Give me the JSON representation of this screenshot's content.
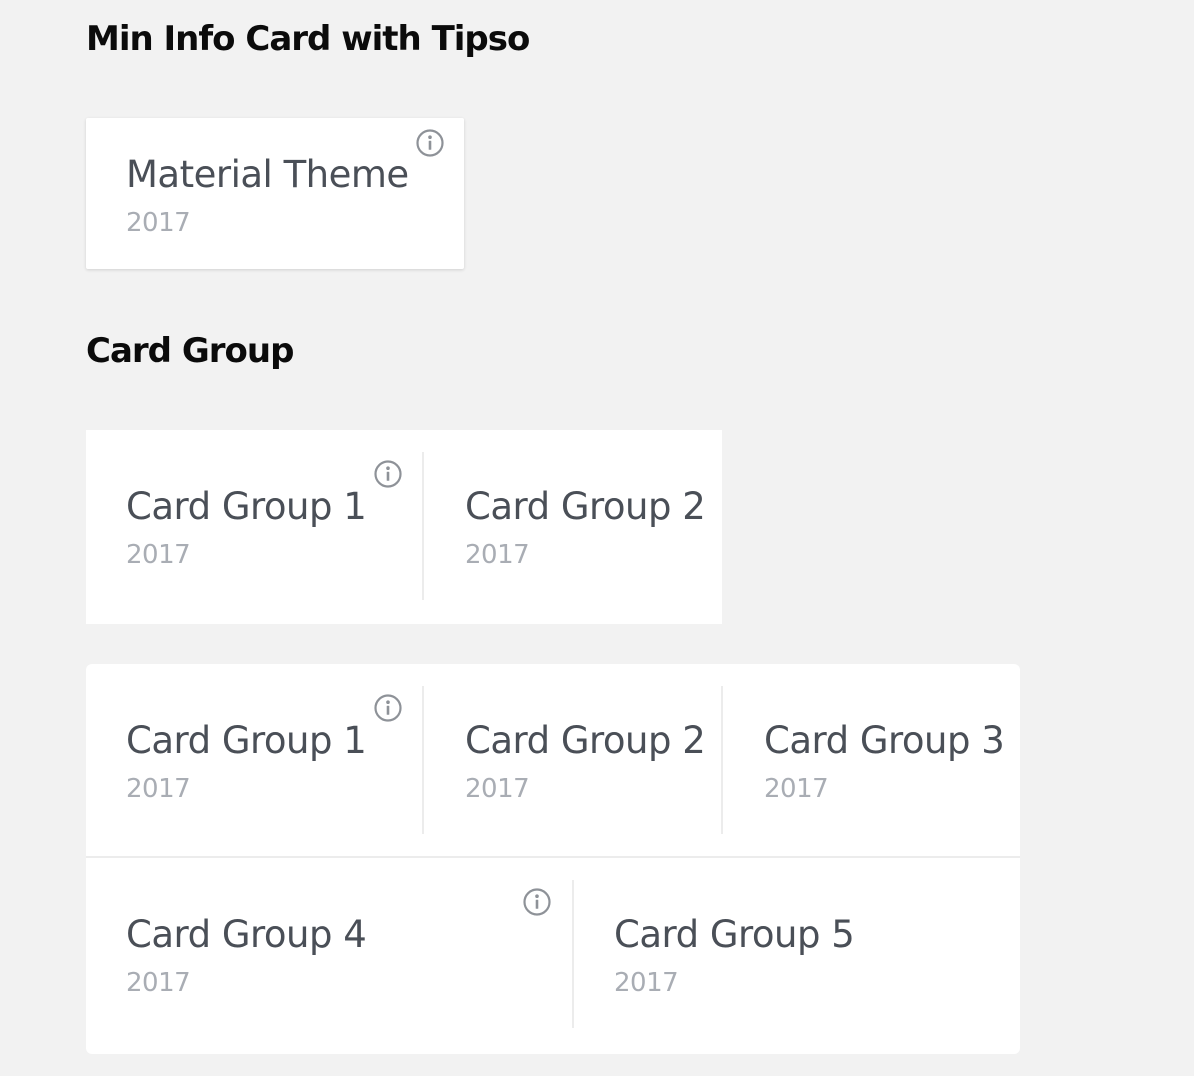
{
  "sections": {
    "min_info": {
      "title": "Min Info Card with Tipso",
      "card": {
        "title": "Material Theme",
        "year": "2017"
      }
    },
    "card_group": {
      "title": "Card Group",
      "group1": {
        "items": [
          {
            "title": "Card Group 1",
            "year": "2017"
          },
          {
            "title": "Card Group 2",
            "year": "2017"
          }
        ]
      },
      "group2": {
        "items": [
          {
            "title": "Card Group 1",
            "year": "2017"
          },
          {
            "title": "Card Group 2",
            "year": "2017"
          },
          {
            "title": "Card Group 3",
            "year": "2017"
          },
          {
            "title": "Card Group 4",
            "year": "2017"
          },
          {
            "title": "Card Group 5",
            "year": "2017"
          }
        ]
      }
    }
  },
  "icons": {
    "tooltip_trigger": "info-circle-icon"
  },
  "colors": {
    "background": "#f2f2f2",
    "card": "#ffffff",
    "title_text": "#4a4f57",
    "year_text": "#a9adb4",
    "icon": "#8e9298"
  }
}
